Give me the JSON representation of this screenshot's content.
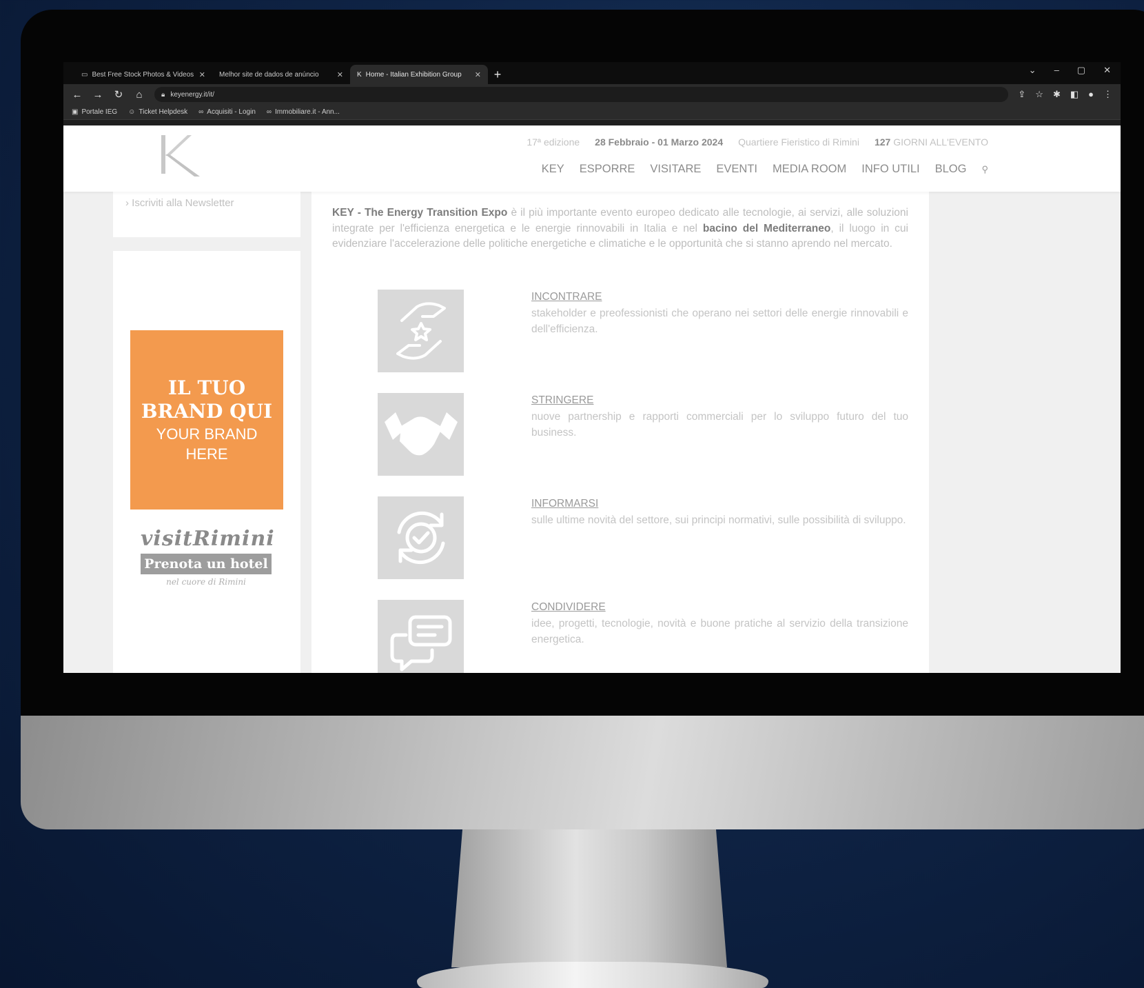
{
  "browser": {
    "tabs": [
      {
        "title": "Best Free Stock Photos & Videos",
        "icon": "pexels-icon",
        "active": false
      },
      {
        "title": "Melhor site de dados de anúncio",
        "icon": "site-icon",
        "active": false
      },
      {
        "title": "Home - Italian Exhibition Group",
        "icon": "key-logo-icon",
        "active": true
      }
    ],
    "new_tab": "+",
    "url": "keyenergy.it/it/",
    "bookmarks": [
      {
        "label": "Portale IEG",
        "icon": "bookmark-icon"
      },
      {
        "label": "Ticket Helpdesk",
        "icon": "user-icon"
      },
      {
        "label": "Acquisiti - Login",
        "icon": "link-icon"
      },
      {
        "label": "Immobiliare.it - Ann...",
        "icon": "link-icon"
      }
    ]
  },
  "header": {
    "edition": "17ª edizione",
    "dates": "28 Febbraio - 01 Marzo 2024",
    "venue": "Quartiere Fieristico di Rimini",
    "countdown_days": "127",
    "countdown_label": "GIORNI ALL'EVENTO",
    "nav": [
      "KEY",
      "ESPORRE",
      "VISITARE",
      "EVENTI",
      "MEDIA ROOM",
      "INFO UTILI",
      "BLOG"
    ]
  },
  "sidebar": {
    "newsletter_link": "Iscriviti alla Newsletter",
    "ad_line1": "IL TUO",
    "ad_line2": "BRAND QUI",
    "ad_line3": "YOUR BRAND",
    "ad_line4": "HERE",
    "visit_title": "visitRimini",
    "visit_button": "Prenota un hotel",
    "visit_sub": "nel cuore di Rimini"
  },
  "intro": {
    "strong1": "KEY - The Energy Transition Expo",
    "text1": " è il più importante evento europeo dedicato alle tecnologie, ai servizi, alle soluzioni integrate per l'efficienza energetica e le energie rinnovabili in Italia e nel ",
    "strong2": "bacino del Mediterraneo",
    "text2": ", il luogo in cui evidenziare l'accelerazione delle politiche energetiche e climatiche e le opportunità che si stanno aprendo nel mercato."
  },
  "features": [
    {
      "title": "INCONTRARE",
      "desc": "stakeholder e preofessionisti che operano nei settori delle energie rinnovabili e dell'efficienza.",
      "icon": "hands-star-icon"
    },
    {
      "title": "STRINGERE",
      "desc": "nuove partnership e rapporti commerciali per lo sviluppo futuro del tuo business.",
      "icon": "handshake-icon"
    },
    {
      "title": "INFORMARSI",
      "desc": "sulle ultime novità del settore, sui principi normativi, sulle possibilità di sviluppo.",
      "icon": "refresh-check-icon"
    },
    {
      "title": "CONDIVIDERE",
      "desc": "idee, progetti, tecnologie, novità e buone pratiche al servizio della transizione energetica.",
      "icon": "chat-bubbles-icon"
    }
  ],
  "colors": {
    "ad_orange": "#f39a4e",
    "icon_tile": "#d9d9d9"
  }
}
